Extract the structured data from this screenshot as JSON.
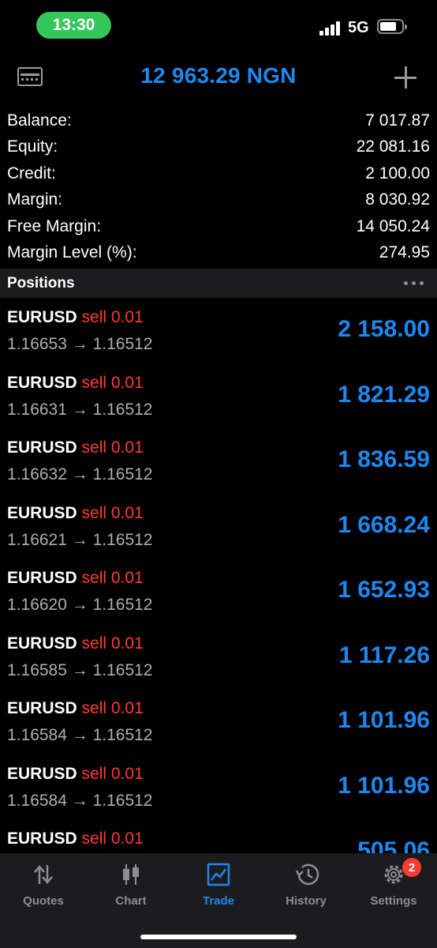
{
  "status_bar": {
    "time": "13:30",
    "network": "5G"
  },
  "header": {
    "title": "12 963.29 NGN",
    "left_icon": "card-icon",
    "right_icon": "plus-icon"
  },
  "summary": [
    {
      "label": "Balance:",
      "value": "7 017.87"
    },
    {
      "label": "Equity:",
      "value": "22 081.16"
    },
    {
      "label": "Credit:",
      "value": "2 100.00"
    },
    {
      "label": "Margin:",
      "value": "8 030.92"
    },
    {
      "label": "Free Margin:",
      "value": "14 050.24"
    },
    {
      "label": "Margin Level (%):",
      "value": "274.95"
    }
  ],
  "positions_title": "Positions",
  "positions": [
    {
      "symbol": "EURUSD",
      "side": "sell 0.01",
      "prices": "1.16653 → 1.16512",
      "profit": "2 158.00"
    },
    {
      "symbol": "EURUSD",
      "side": "sell 0.01",
      "prices": "1.16631 → 1.16512",
      "profit": "1 821.29"
    },
    {
      "symbol": "EURUSD",
      "side": "sell 0.01",
      "prices": "1.16632 → 1.16512",
      "profit": "1 836.59"
    },
    {
      "symbol": "EURUSD",
      "side": "sell 0.01",
      "prices": "1.16621 → 1.16512",
      "profit": "1 668.24"
    },
    {
      "symbol": "EURUSD",
      "side": "sell 0.01",
      "prices": "1.16620 → 1.16512",
      "profit": "1 652.93"
    },
    {
      "symbol": "EURUSD",
      "side": "sell 0.01",
      "prices": "1.16585 → 1.16512",
      "profit": "1 117.26"
    },
    {
      "symbol": "EURUSD",
      "side": "sell 0.01",
      "prices": "1.16584 → 1.16512",
      "profit": "1 101.96"
    },
    {
      "symbol": "EURUSD",
      "side": "sell 0.01",
      "prices": "1.16584 → 1.16512",
      "profit": "1 101.96"
    },
    {
      "symbol": "EURUSD",
      "side": "sell 0.01",
      "prices": "",
      "profit": "505.06"
    }
  ],
  "tabs": [
    {
      "label": "Quotes",
      "icon": "quotes-icon"
    },
    {
      "label": "Chart",
      "icon": "chart-icon"
    },
    {
      "label": "Trade",
      "icon": "trade-icon",
      "active": true
    },
    {
      "label": "History",
      "icon": "history-icon"
    },
    {
      "label": "Settings",
      "icon": "settings-icon",
      "badge": "2"
    }
  ],
  "colors": {
    "accent": "#1e88f0",
    "sell": "#ff3b30",
    "status_pill": "#34c759",
    "badge": "#ff3b30"
  }
}
